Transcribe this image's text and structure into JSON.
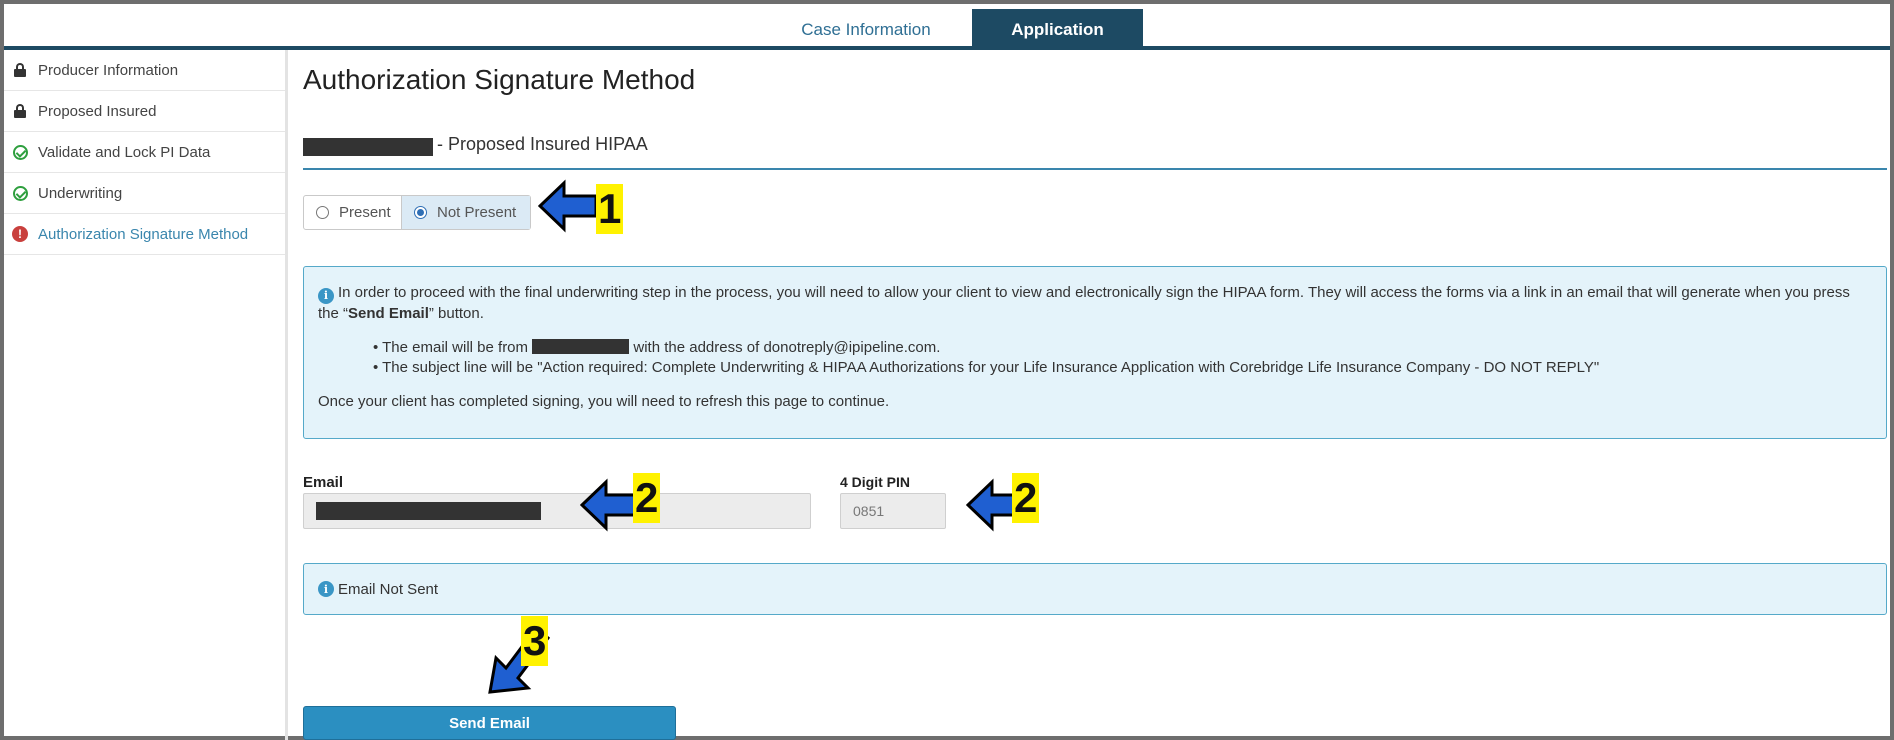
{
  "tabs": [
    {
      "label": "Case Information",
      "active": false
    },
    {
      "label": "Application",
      "active": true
    }
  ],
  "sidebar": {
    "items": [
      {
        "label": "Producer Information",
        "status": "locked"
      },
      {
        "label": "Proposed Insured",
        "status": "locked"
      },
      {
        "label": "Validate and Lock PI Data",
        "status": "complete"
      },
      {
        "label": "Underwriting",
        "status": "complete"
      },
      {
        "label": "Authorization Signature Method",
        "status": "error",
        "active": true
      }
    ]
  },
  "main": {
    "title": "Authorization Signature Method",
    "section_heading": "- Proposed Insured HIPAA",
    "radio": {
      "options": [
        "Present",
        "Not Present"
      ],
      "selected": "Not Present"
    },
    "info": {
      "intro": "In order to proceed with the final underwriting step in the process, you will need to allow your client to view and electronically sign the HIPAA form. They will access the forms via a link in an email that will generate when you press the “",
      "intro_bold": "Send Email",
      "intro_end": "” button.",
      "bullet1_pre": "• The email will be from",
      "bullet1_post": "with the address of donotreply@ipipeline.com.",
      "bullet2": "• The subject line will be \"Action required: Complete Underwriting & HIPAA Authorizations for your Life Insurance Application with Corebridge Life Insurance Company - DO NOT REPLY\"",
      "footer": "Once your client has completed signing, you will need to refresh this page to continue."
    },
    "email_label": "Email",
    "pin_label": "4 Digit PIN",
    "pin_value": "0851",
    "status_text": "Email Not Sent",
    "send_button": "Send Email"
  },
  "annotations": {
    "badge1": "1",
    "badge2a": "2",
    "badge2b": "2",
    "badge3": "3",
    "badge_color": "#fff200",
    "arrow_color": "#1f5fd1"
  }
}
